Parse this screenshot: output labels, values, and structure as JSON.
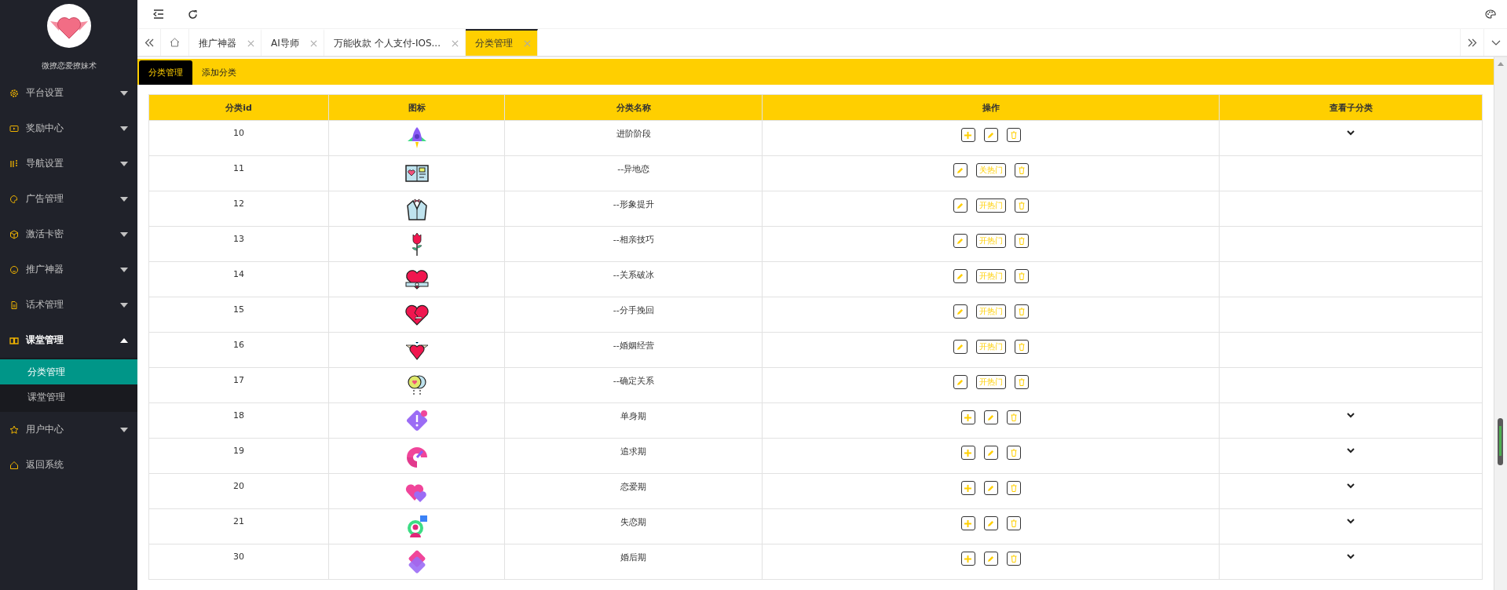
{
  "sidebar": {
    "brand": "微撩恋爱撩妹术",
    "items": [
      {
        "label": "平台设置",
        "kind": "menu",
        "expanded": false
      },
      {
        "label": "奖励中心",
        "kind": "menu",
        "expanded": false
      },
      {
        "label": "导航设置",
        "kind": "menu",
        "expanded": false
      },
      {
        "label": "广告管理",
        "kind": "menu",
        "expanded": false
      },
      {
        "label": "激活卡密",
        "kind": "menu",
        "expanded": false
      },
      {
        "label": "推广神器",
        "kind": "menu",
        "expanded": false
      },
      {
        "label": "话术管理",
        "kind": "menu",
        "expanded": false
      },
      {
        "label": "课堂管理",
        "kind": "menu",
        "expanded": true,
        "children": [
          {
            "label": "分类管理",
            "selected": true
          },
          {
            "label": "课堂管理",
            "selected": false
          }
        ]
      },
      {
        "label": "用户中心",
        "kind": "menu",
        "expanded": false
      },
      {
        "label": "返回系统",
        "kind": "link",
        "expanded": false
      }
    ]
  },
  "tabs": [
    {
      "label": "推广神器",
      "selected": false
    },
    {
      "label": "AI导师",
      "selected": false
    },
    {
      "label": "万能收款 个人支付-IOS...",
      "selected": false
    },
    {
      "label": "分类管理",
      "selected": true
    }
  ],
  "subtabs": [
    {
      "label": "分类管理",
      "selected": true
    },
    {
      "label": "添加分类",
      "selected": false
    }
  ],
  "table": {
    "columns": [
      "分类id",
      "图标",
      "分类名称",
      "操作",
      "查看子分类"
    ],
    "rows": [
      {
        "id": "10",
        "name": "进阶阶段",
        "kind": "parent"
      },
      {
        "id": "11",
        "name": "--异地恋",
        "kind": "child",
        "hot_label": "关热门"
      },
      {
        "id": "12",
        "name": "--形象提升",
        "kind": "child",
        "hot_label": "开热门"
      },
      {
        "id": "13",
        "name": "--相亲技巧",
        "kind": "child",
        "hot_label": "开热门"
      },
      {
        "id": "14",
        "name": "--关系破冰",
        "kind": "child",
        "hot_label": "开热门"
      },
      {
        "id": "15",
        "name": "--分手挽回",
        "kind": "child",
        "hot_label": "开热门"
      },
      {
        "id": "16",
        "name": "--婚姻经营",
        "kind": "child",
        "hot_label": "开热门"
      },
      {
        "id": "17",
        "name": "--确定关系",
        "kind": "child",
        "hot_label": "开热门"
      },
      {
        "id": "18",
        "name": "单身期",
        "kind": "parent"
      },
      {
        "id": "19",
        "name": "追求期",
        "kind": "parent"
      },
      {
        "id": "20",
        "name": "恋爱期",
        "kind": "parent"
      },
      {
        "id": "21",
        "name": "失恋期",
        "kind": "parent"
      },
      {
        "id": "30",
        "name": "婚后期",
        "kind": "parent"
      }
    ]
  }
}
